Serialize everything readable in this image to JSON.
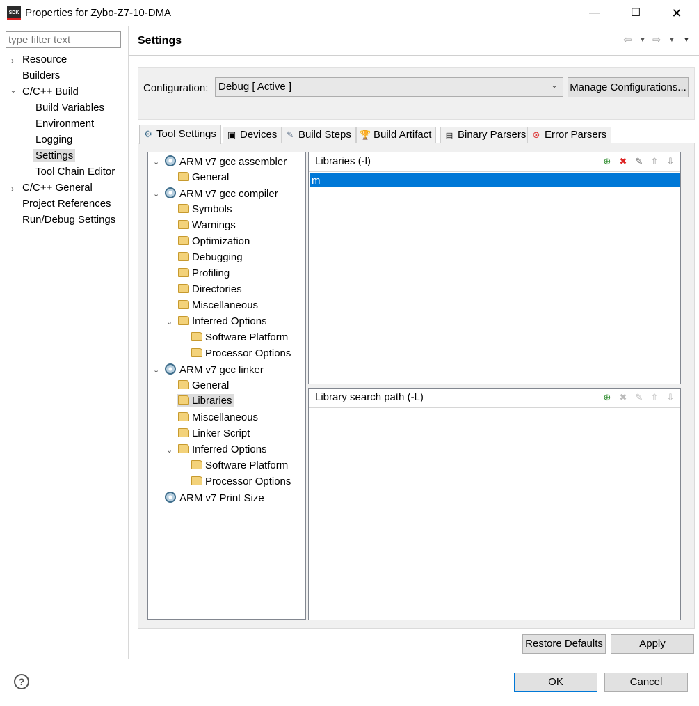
{
  "window": {
    "title": "Properties for Zybo-Z7-10-DMA",
    "app_icon_text": "SDK",
    "minimize": "—",
    "maximize": "☐",
    "close": "✕"
  },
  "nav": {
    "filter_placeholder": "type filter text",
    "items": [
      {
        "label": "Resource",
        "expander": "›"
      },
      {
        "label": "Builders"
      },
      {
        "label": "C/C++ Build",
        "expander": "⌄"
      },
      {
        "label": "Build Variables"
      },
      {
        "label": "Environment"
      },
      {
        "label": "Logging"
      },
      {
        "label": "Settings",
        "selected": true
      },
      {
        "label": "Tool Chain Editor"
      },
      {
        "label": "C/C++ General",
        "expander": "›"
      },
      {
        "label": "Project References"
      },
      {
        "label": "Run/Debug Settings"
      }
    ]
  },
  "header": {
    "title": "Settings",
    "icons": [
      "back-arrow-icon",
      "dropdown-icon",
      "forward-arrow-icon",
      "dropdown-icon",
      "view-menu-icon"
    ]
  },
  "configuration": {
    "label": "Configuration:",
    "value": "Debug  [ Active ]",
    "manage_button": "Manage Configurations..."
  },
  "tabs": [
    {
      "label": "Tool Settings",
      "active": true
    },
    {
      "label": "Devices"
    },
    {
      "label": "Build Steps"
    },
    {
      "label": "Build Artifact"
    },
    {
      "label": "Binary Parsers"
    },
    {
      "label": "Error Parsers"
    }
  ],
  "tool_tree": [
    {
      "label": "ARM v7 gcc assembler",
      "level": 0,
      "icon": "gear",
      "expander": "⌄"
    },
    {
      "label": "General",
      "level": 1,
      "icon": "folder"
    },
    {
      "label": "ARM v7 gcc compiler",
      "level": 0,
      "icon": "gear",
      "expander": "⌄"
    },
    {
      "label": "Symbols",
      "level": 1,
      "icon": "folder"
    },
    {
      "label": "Warnings",
      "level": 1,
      "icon": "folder"
    },
    {
      "label": "Optimization",
      "level": 1,
      "icon": "folder"
    },
    {
      "label": "Debugging",
      "level": 1,
      "icon": "folder"
    },
    {
      "label": "Profiling",
      "level": 1,
      "icon": "folder"
    },
    {
      "label": "Directories",
      "level": 1,
      "icon": "folder"
    },
    {
      "label": "Miscellaneous",
      "level": 1,
      "icon": "folder"
    },
    {
      "label": "Inferred Options",
      "level": 1,
      "icon": "folder",
      "expander": "⌄"
    },
    {
      "label": "Software Platform",
      "level": 2,
      "icon": "folder"
    },
    {
      "label": "Processor Options",
      "level": 2,
      "icon": "folder"
    },
    {
      "label": "ARM v7 gcc linker",
      "level": 0,
      "icon": "gear",
      "expander": "⌄"
    },
    {
      "label": "General",
      "level": 1,
      "icon": "folder"
    },
    {
      "label": "Libraries",
      "level": 1,
      "icon": "folder",
      "selected": true
    },
    {
      "label": "Miscellaneous",
      "level": 1,
      "icon": "folder"
    },
    {
      "label": "Linker Script",
      "level": 1,
      "icon": "folder"
    },
    {
      "label": "Inferred Options",
      "level": 1,
      "icon": "folder",
      "expander": "⌄"
    },
    {
      "label": "Software Platform",
      "level": 2,
      "icon": "folder"
    },
    {
      "label": "Processor Options",
      "level": 2,
      "icon": "folder"
    },
    {
      "label": "ARM v7 Print Size",
      "level": 0,
      "icon": "gear"
    }
  ],
  "libraries": {
    "title": "Libraries (-l)",
    "items": [
      "m"
    ]
  },
  "library_search_path": {
    "title": "Library search path (-L)",
    "items": []
  },
  "buttons": {
    "restore_defaults": "Restore Defaults",
    "apply": "Apply",
    "ok": "OK",
    "cancel": "Cancel",
    "help": "?"
  },
  "colors": {
    "selection": "#0078d7",
    "panel_bg": "#f0f0f0"
  }
}
